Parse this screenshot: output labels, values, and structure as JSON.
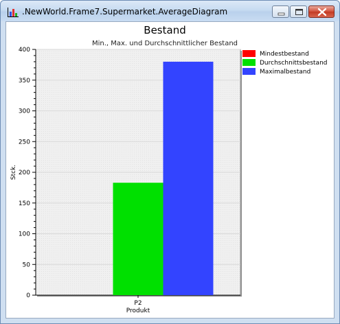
{
  "window": {
    "title": ".NewWorld.Frame7.Supermarket.AverageDiagram",
    "app_icon": "bar-chart-icon",
    "controls": [
      "minimize-icon",
      "maximize-icon",
      "close-icon"
    ],
    "close_color": "#c7432b"
  },
  "chart_data": {
    "type": "bar",
    "title": "Bestand",
    "subtitle": "Min., Max. und Durchschnittlicher Bestand",
    "xlabel": "Produkt",
    "ylabel": "Stck.",
    "categories": [
      "P2"
    ],
    "series": [
      {
        "name": "Mindestbestand",
        "values": [
          0
        ],
        "color": "#ff0000"
      },
      {
        "name": "Durchschnittsbestand",
        "values": [
          183
        ],
        "color": "#00e000"
      },
      {
        "name": "Maximalbestand",
        "values": [
          380
        ],
        "color": "#3344ff"
      }
    ],
    "ylim": [
      0,
      400
    ],
    "yticks": [
      0,
      50,
      100,
      150,
      200,
      250,
      300,
      350,
      400
    ],
    "grid": true,
    "legend": "top-right"
  }
}
